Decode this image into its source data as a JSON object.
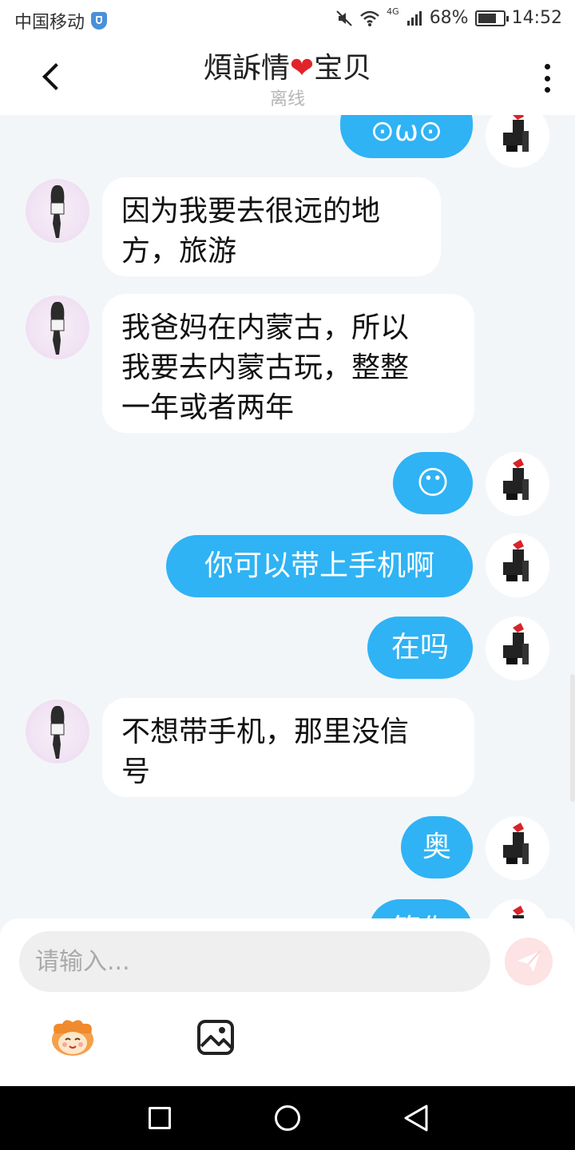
{
  "status_bar": {
    "carrier": "中国移动",
    "network": "4G",
    "battery": "68%",
    "time": "14:52"
  },
  "header": {
    "title_part1": "煩訴情",
    "title_heart": "❤",
    "title_part2": "宝贝",
    "status": "离线"
  },
  "messages": [
    {
      "side": "out",
      "text": "⊙ω⊙"
    },
    {
      "side": "in",
      "text": "因为我要去很远的地\n方，旅游"
    },
    {
      "side": "in",
      "text": "我爸妈在内蒙古，所以\n我要去内蒙古玩，整整\n一年或者两年"
    },
    {
      "side": "out",
      "text": "😶"
    },
    {
      "side": "out",
      "text": "你可以带上手机啊"
    },
    {
      "side": "out",
      "text": "在吗"
    },
    {
      "side": "in",
      "text": "不想带手机，那里没信\n号"
    },
    {
      "side": "out",
      "text": "奥"
    },
    {
      "side": "out",
      "text": "等你"
    }
  ],
  "composer": {
    "placeholder": "请输入..."
  },
  "colors": {
    "outgoing_bubble": "#2fb3f4",
    "incoming_bubble": "#ffffff",
    "chat_background": "#f3f6f9",
    "heart": "#e0242a"
  },
  "icons": [
    "shield-icon",
    "mute-icon",
    "wifi-icon",
    "signal-icon",
    "battery-icon",
    "back-arrow-icon",
    "more-vertical-icon",
    "send-icon",
    "emoji-icon",
    "image-icon",
    "nav-recent-icon",
    "nav-home-icon",
    "nav-back-icon"
  ]
}
